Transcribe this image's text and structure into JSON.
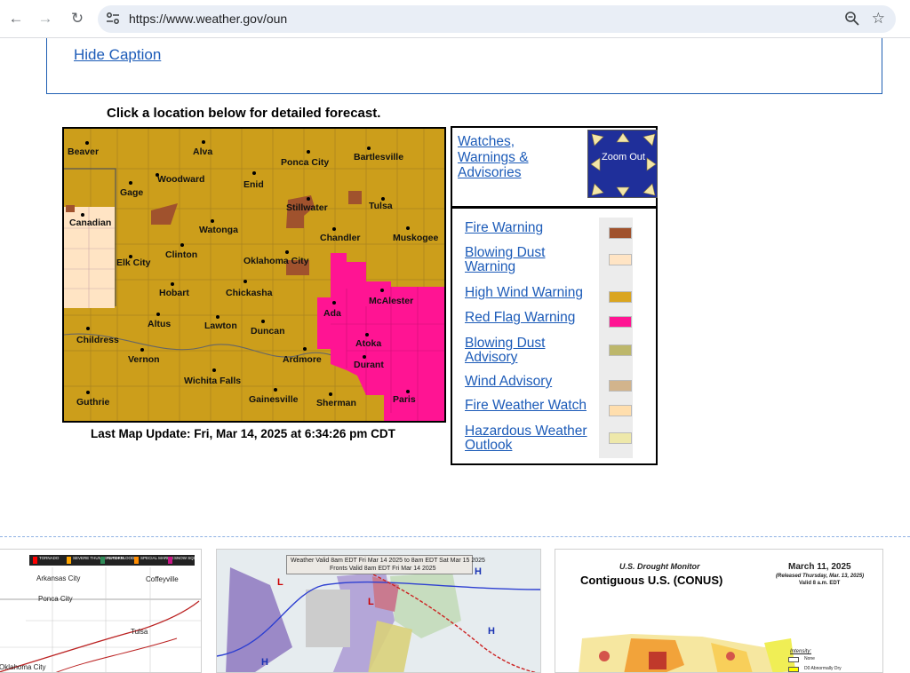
{
  "browser": {
    "url": "https://www.weather.gov/oun",
    "icons": [
      "back-arrow-icon",
      "forward-arrow-icon",
      "reload-icon",
      "site-settings-icon",
      "zoom-icon",
      "bookmark-star-icon"
    ]
  },
  "caption": {
    "hide_label": "Hide Caption"
  },
  "map": {
    "title": "Click a location below for detailed forecast.",
    "last_update": "Last Map Update: Fri, Mar 14, 2025 at 6:34:26 pm CDT",
    "cities": [
      "Beaver",
      "Alva",
      "Ponca City",
      "Bartlesville",
      "Woodward",
      "Enid",
      "Gage",
      "Stillwater",
      "Tulsa",
      "Canadian",
      "Watonga",
      "Chandler",
      "Muskogee",
      "Clinton",
      "Elk City",
      "Oklahoma City",
      "Hobart",
      "Chickasha",
      "McAlester",
      "Ada",
      "Altus",
      "Lawton",
      "Duncan",
      "Childress",
      "Atoka",
      "Vernon",
      "Ardmore",
      "Durant",
      "Wichita Falls",
      "Guthrie",
      "Gainesville",
      "Sherman",
      "Paris"
    ]
  },
  "watches": {
    "link": "Watches, Warnings & Advisories",
    "zoom_out": "Zoom Out"
  },
  "legend": [
    {
      "label": "Fire Warning",
      "color": "#a0522d"
    },
    {
      "label": "Blowing Dust Warning",
      "color": "#ffe4c4"
    },
    {
      "label": "High Wind Warning",
      "color": "#daa520"
    },
    {
      "label": "Red Flag Warning",
      "color": "#ff1493"
    },
    {
      "label": "Blowing Dust Advisory",
      "color": "#bdb76b"
    },
    {
      "label": "Wind Advisory",
      "color": "#d2b48c"
    },
    {
      "label": "Fire Weather Watch",
      "color": "#ffdead"
    },
    {
      "label": "Hazardous Weather Outlook",
      "color": "#eee8aa"
    }
  ],
  "thumbnails": {
    "hazards": {
      "legend": [
        "TORNADO",
        "SEVERE THUNDERSTORM",
        "FLASH FLOOD",
        "SPECIAL MARINE",
        "SNOW SQUALL"
      ],
      "cities": [
        "Arkansas City",
        "Coffeyville",
        "Ponca City",
        "Tulsa",
        "Oklahoma City"
      ]
    },
    "surface": {
      "header1": "Weather Valid 8am EDT Fri Mar 14 2025 to 8am EDT Sat Mar 15 2025",
      "header2": "Fronts Valid 8am EDT Fri Mar 14 2025"
    },
    "drought": {
      "title": "U.S. Drought Monitor",
      "region": "Contiguous U.S. (CONUS)",
      "date": "March 11, 2025",
      "released": "(Released Thursday, Mar. 13, 2025)",
      "valid": "Valid 8 a.m. EDT",
      "intensity": "Intensity:",
      "levels": [
        "None",
        "D0 Abnormally Dry"
      ]
    }
  }
}
